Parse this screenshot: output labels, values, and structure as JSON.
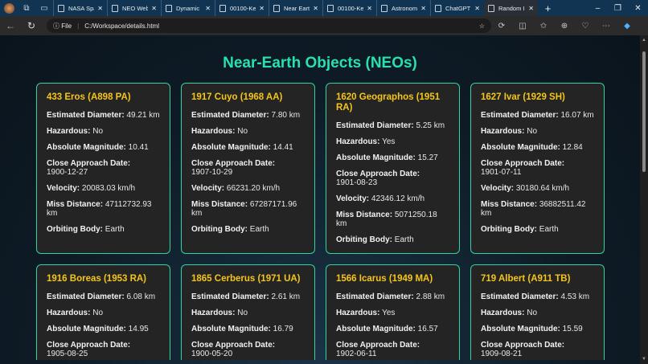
{
  "browser": {
    "tabs": [
      {
        "label": "NASA Spa",
        "active": false
      },
      {
        "label": "NEO Web",
        "active": false
      },
      {
        "label": "Dynamic",
        "active": false
      },
      {
        "label": "00100-Ke",
        "active": false
      },
      {
        "label": "Near Eart",
        "active": false
      },
      {
        "label": "00100-Ke",
        "active": false
      },
      {
        "label": "Astronom",
        "active": false
      },
      {
        "label": "ChatGPT",
        "active": false
      },
      {
        "label": "Random I",
        "active": true
      }
    ],
    "address_scheme": "File",
    "address": "C:/Workspace/details.html"
  },
  "page": {
    "title": "Near-Earth Objects (NEOs)"
  },
  "labels": {
    "diameter": "Estimated Diameter:",
    "hazardous": "Hazardous:",
    "magnitude": "Absolute Magnitude:",
    "date": "Close Approach Date:",
    "velocity": "Velocity:",
    "miss": "Miss Distance:",
    "orbit": "Orbiting Body:"
  },
  "neos": [
    {
      "name": "433 Eros (A898 PA)",
      "diameter": "49.21 km",
      "hazardous": "No",
      "magnitude": "10.41",
      "date": "1900-12-27",
      "velocity": "20083.03 km/h",
      "miss": "47112732.93 km",
      "orbit": "Earth"
    },
    {
      "name": "1917 Cuyo (1968 AA)",
      "diameter": "7.80 km",
      "hazardous": "No",
      "magnitude": "14.41",
      "date": "1907-10-29",
      "velocity": "66231.20 km/h",
      "miss": "67287171.96 km",
      "orbit": "Earth"
    },
    {
      "name": "1620 Geographos (1951 RA)",
      "diameter": "5.25 km",
      "hazardous": "Yes",
      "magnitude": "15.27",
      "date": "1901-08-23",
      "velocity": "42346.12 km/h",
      "miss": "5071250.18 km",
      "orbit": "Earth"
    },
    {
      "name": "1627 Ivar (1929 SH)",
      "diameter": "16.07 km",
      "hazardous": "No",
      "magnitude": "12.84",
      "date": "1901-07-11",
      "velocity": "30180.64 km/h",
      "miss": "36882511.42 km",
      "orbit": "Earth"
    },
    {
      "name": "1916 Boreas (1953 RA)",
      "diameter": "6.08 km",
      "hazardous": "No",
      "magnitude": "14.95",
      "date": "1905-08-25"
    },
    {
      "name": "1865 Cerberus (1971 UA)",
      "diameter": "2.61 km",
      "hazardous": "No",
      "magnitude": "16.79",
      "date": "1900-05-20"
    },
    {
      "name": "1566 Icarus (1949 MA)",
      "diameter": "2.88 km",
      "hazardous": "Yes",
      "magnitude": "16.57",
      "date": "1902-06-11"
    },
    {
      "name": "719 Albert (A911 TB)",
      "diameter": "4.53 km",
      "hazardous": "No",
      "magnitude": "15.59",
      "date": "1909-08-21"
    }
  ]
}
